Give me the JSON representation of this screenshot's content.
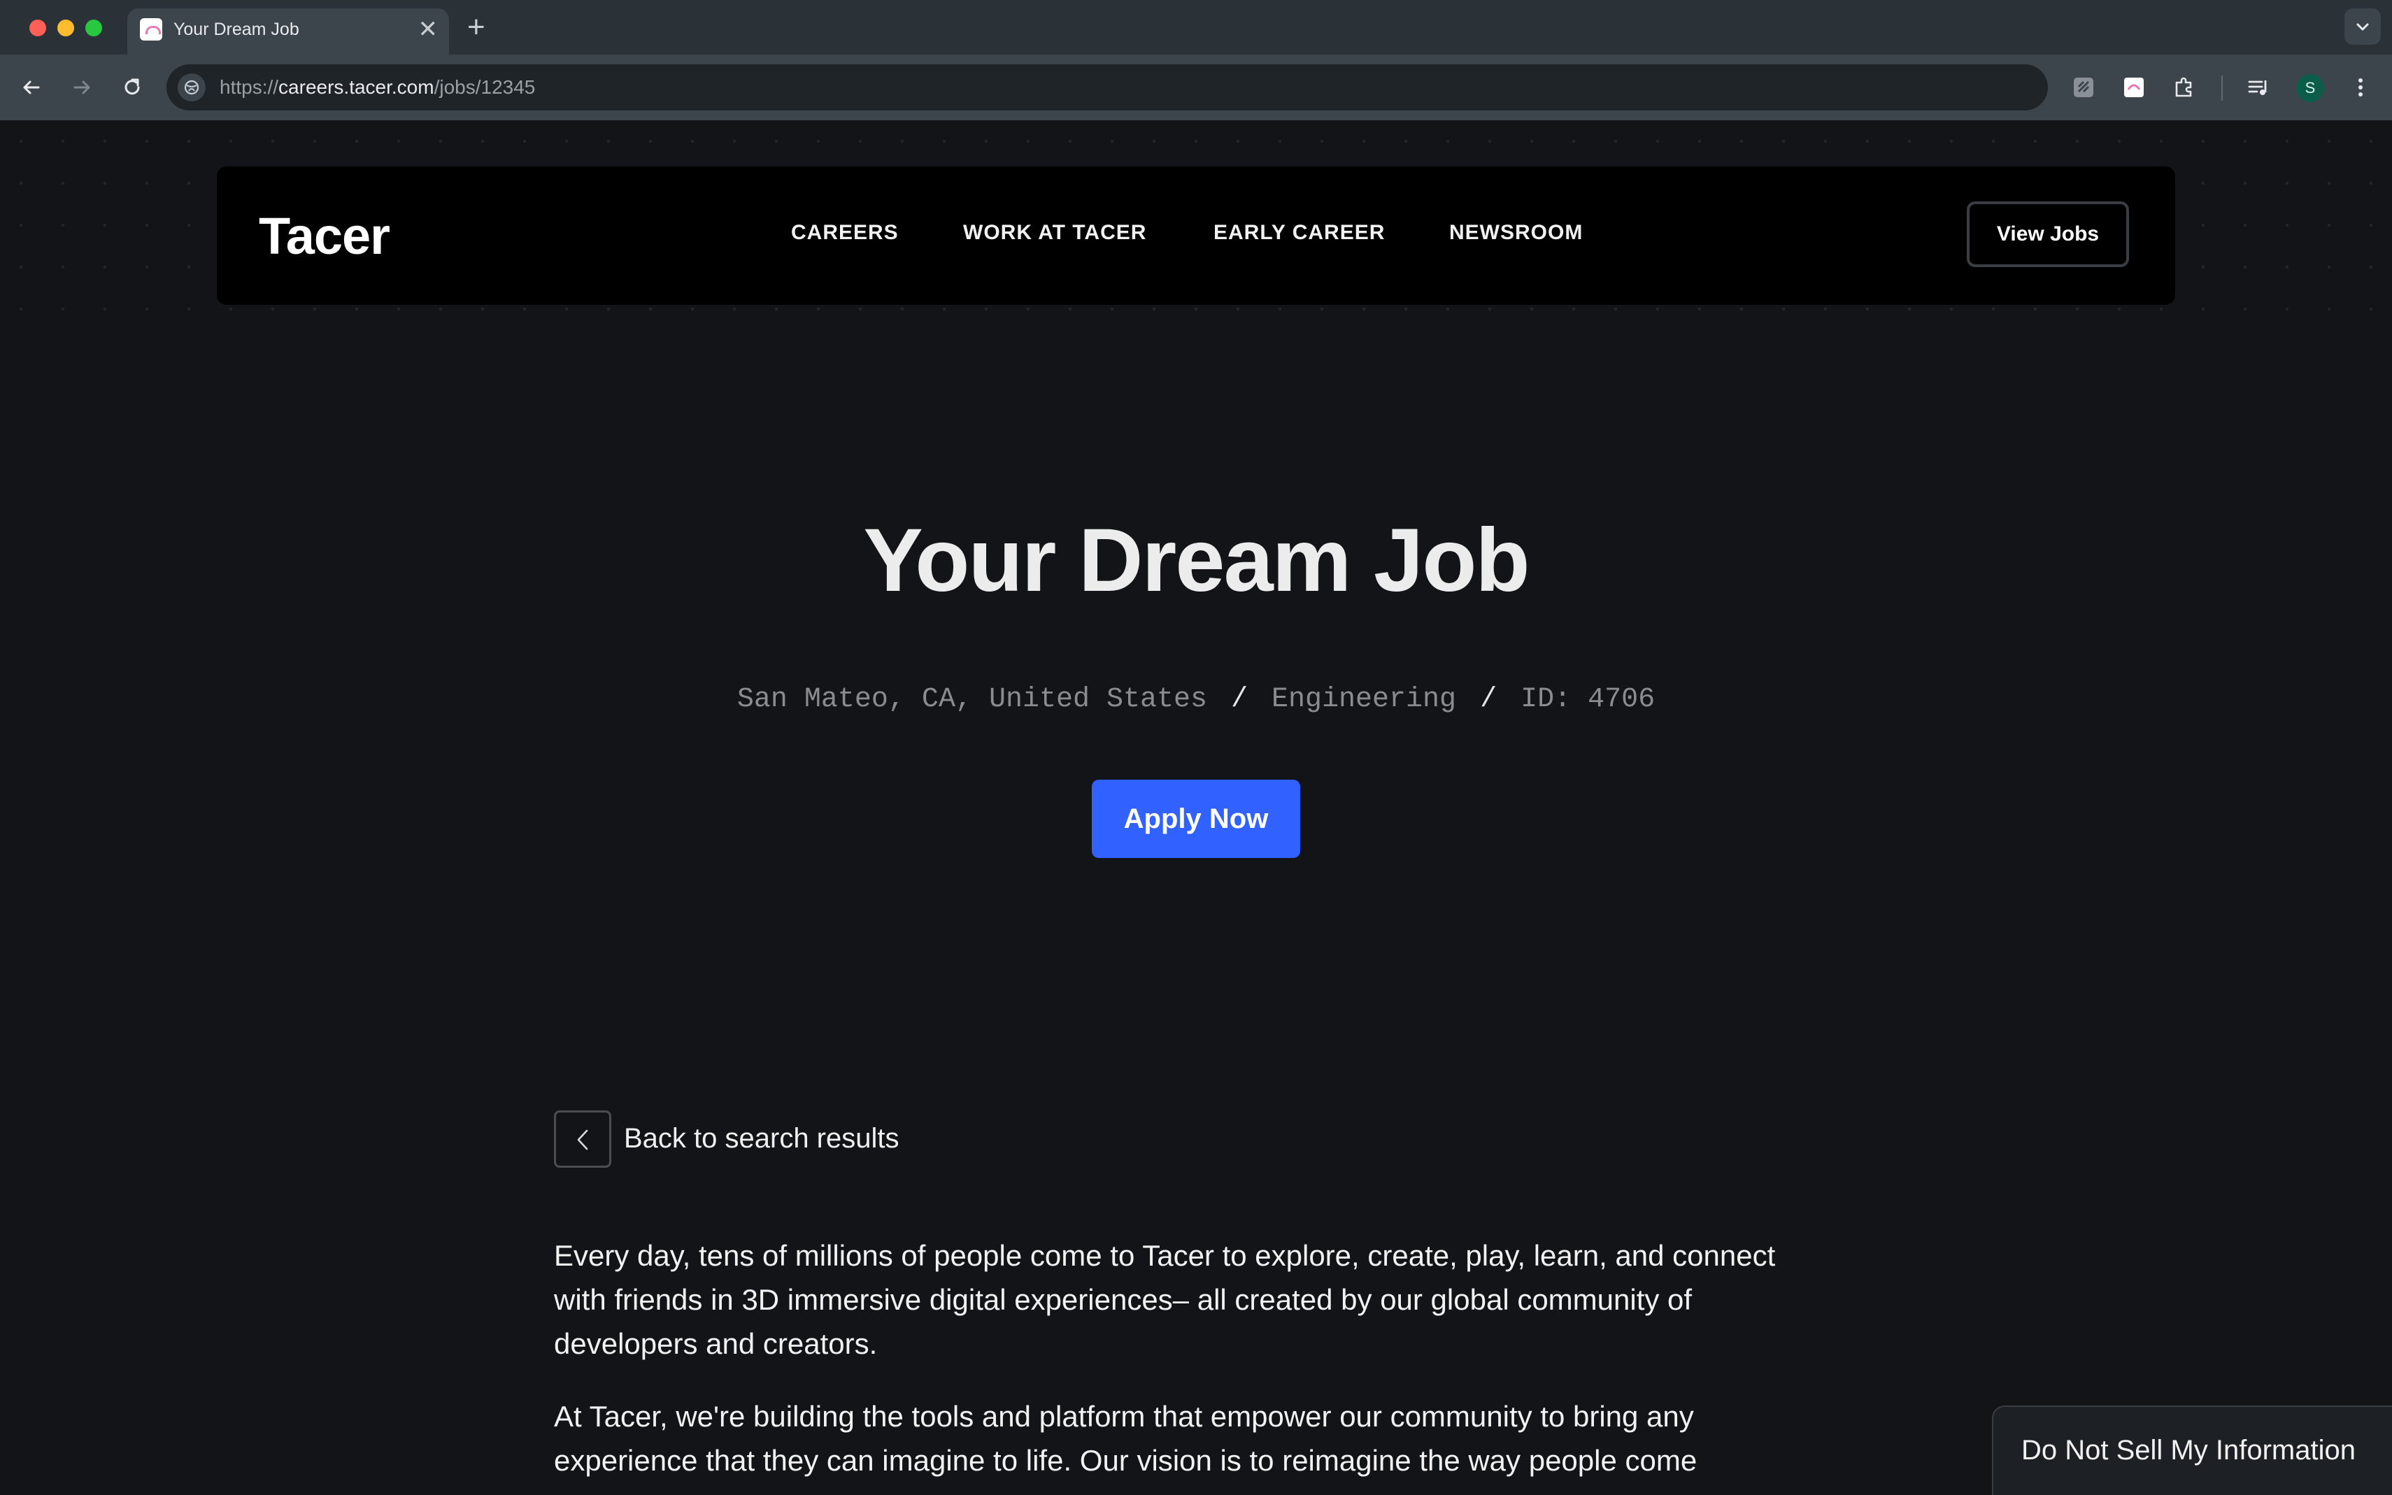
{
  "browser": {
    "tab_title": "Your Dream Job",
    "tab_close": "✕",
    "new_tab": "+",
    "url_prefix": "https://",
    "url_host": "careers.tacer.com",
    "url_path": "/jobs/12345",
    "profile_initial": "S"
  },
  "site": {
    "logo": "Tacer",
    "nav": [
      "CAREERS",
      "WORK AT TACER",
      "EARLY CAREER",
      "NEWSROOM"
    ],
    "view_jobs": "View Jobs"
  },
  "job": {
    "title": "Your Dream Job",
    "location": "San Mateo, CA, United States",
    "separator": "/",
    "department": "Engineering",
    "id_label": "ID: 4706",
    "apply_label": "Apply Now",
    "back_label": "Back to search results",
    "paragraphs": [
      "Every day, tens of millions of people come to Tacer to explore, create, play, learn, and connect with friends in 3D immersive digital experiences– all created by our global community of developers and creators.",
      "At Tacer, we're building the tools and platform that empower our community to bring any experience that they can imagine to life. Our vision is to reimagine the way people come"
    ]
  },
  "footer": {
    "do_not_sell": "Do Not Sell My Information"
  },
  "icons": [
    "back-arrow-icon",
    "forward-arrow-icon",
    "reload-icon",
    "site-info-icon",
    "tab-search-chevron-icon",
    "extension-icon",
    "puzzle-icon",
    "media-icon",
    "menu-kebab-icon",
    "chevron-left-icon"
  ],
  "colors": {
    "page_bg": "#131417",
    "nav_bg": "#000000",
    "apply_blue": "#3161ff",
    "meta_gray": "#8a8c90"
  }
}
